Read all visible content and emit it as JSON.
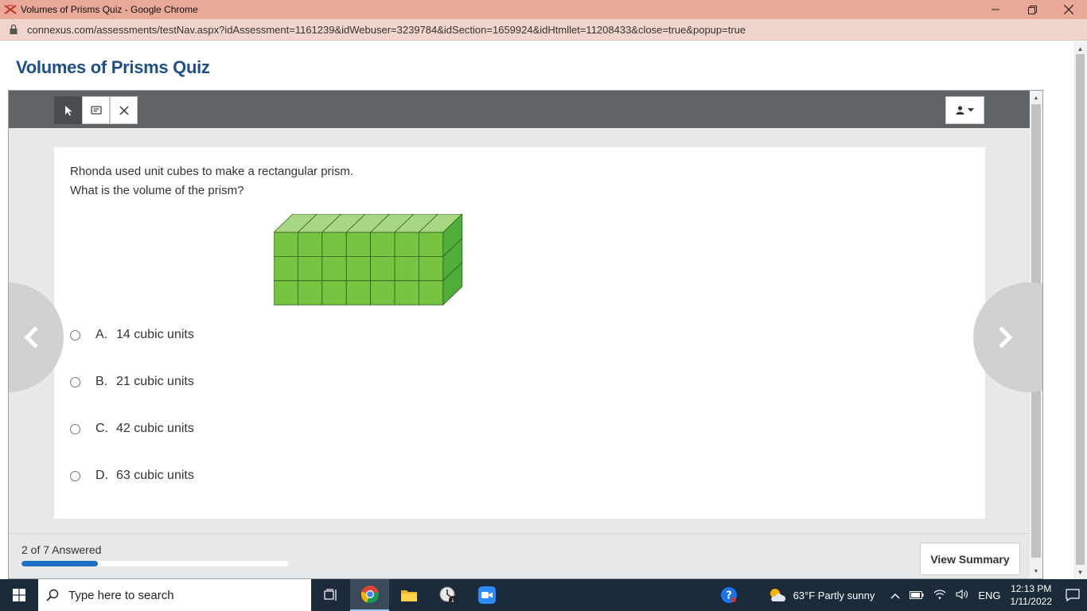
{
  "browser": {
    "window_title": "Volumes of Prisms Quiz - Google Chrome",
    "url": "connexus.com/assessments/testNav.aspx?idAssessment=1161239&idWebuser=3239784&idSection=1659924&idHtmllet=11208433&close=true&popup=true"
  },
  "page": {
    "title": "Volumes of Prisms Quiz"
  },
  "question": {
    "line1": "Rhonda used unit cubes to make a rectangular prism.",
    "line2": "What is the volume of the prism?",
    "figure": {
      "cubes_long": 7,
      "cubes_high": 3,
      "cubes_deep": 1
    },
    "choices": [
      {
        "letter": "A.",
        "text": "14 cubic units"
      },
      {
        "letter": "B.",
        "text": "21 cubic units"
      },
      {
        "letter": "C.",
        "text": "42 cubic units"
      },
      {
        "letter": "D.",
        "text": "63 cubic units"
      }
    ]
  },
  "footer": {
    "answered_text": "2 of 7 Answered",
    "answered_fraction": 0.2857,
    "summary_label": "View Summary"
  },
  "taskbar": {
    "search_placeholder": "Type here to search",
    "weather": "63°F  Partly sunny",
    "language": "ENG",
    "time": "12:13 PM",
    "date": "1/11/2022"
  },
  "colors": {
    "title_blue": "#1f4e8c",
    "prism_front": "#76c442",
    "prism_top": "#a8d784",
    "prism_side": "#4fae3a",
    "progress": "#1d6fc4"
  }
}
